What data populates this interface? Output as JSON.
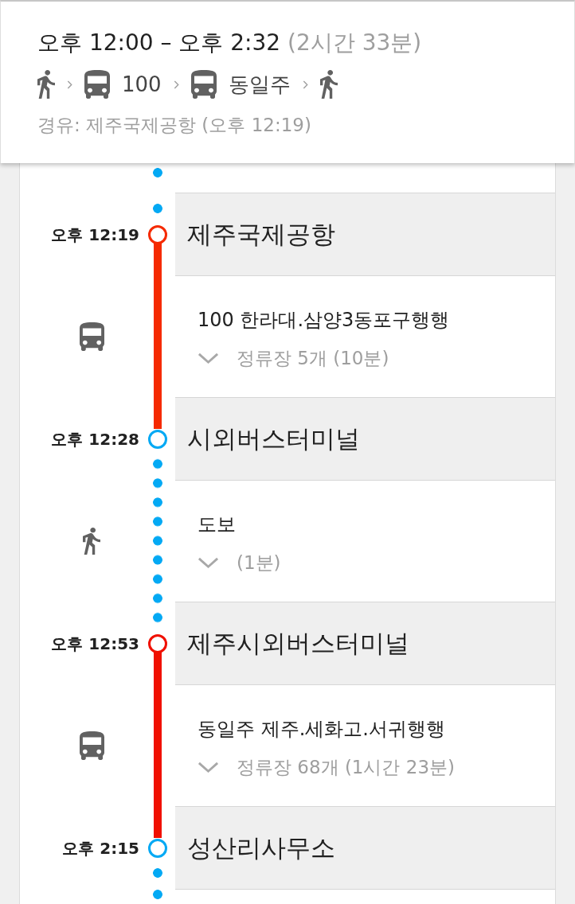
{
  "summary": {
    "time_range": "오후 12:00 – 오후 2:32",
    "duration": "(2시간 33분)",
    "steps": [
      {
        "kind": "walk"
      },
      {
        "kind": "bus",
        "label": "100"
      },
      {
        "kind": "bus",
        "label": "동일주"
      },
      {
        "kind": "walk"
      }
    ],
    "via": "경유: 제주국제공항 (오후 12:19)"
  },
  "timeline": [
    {
      "kind": "walk",
      "color": "#03a9f4"
    },
    {
      "kind": "stop",
      "time": "오후 12:19",
      "name": "제주국제공항",
      "color": "#f52a00"
    },
    {
      "kind": "bus",
      "color": "#f52a00",
      "title": "100 한라대.삼양3동포구행행",
      "detail": "정류장 5개 (10분)",
      "expanded": false
    },
    {
      "kind": "stop",
      "time": "오후 12:28",
      "name": "시외버스터미널",
      "color": "#03a9f4"
    },
    {
      "kind": "walk",
      "color": "#03a9f4",
      "title": "도보",
      "detail": "(1분)",
      "expanded": false
    },
    {
      "kind": "stop",
      "time": "오후 12:53",
      "name": "제주시외버스터미널",
      "color": "#f01000"
    },
    {
      "kind": "bus",
      "color": "#f01000",
      "title": "동일주 제주.세화고.서귀행행",
      "detail": "정류장 68개 (1시간 23분)",
      "expanded": false
    },
    {
      "kind": "stop",
      "time": "오후 2:15",
      "name": "성산리사무소",
      "color": "#03a9f4"
    },
    {
      "kind": "walk",
      "color": "#03a9f4"
    }
  ]
}
